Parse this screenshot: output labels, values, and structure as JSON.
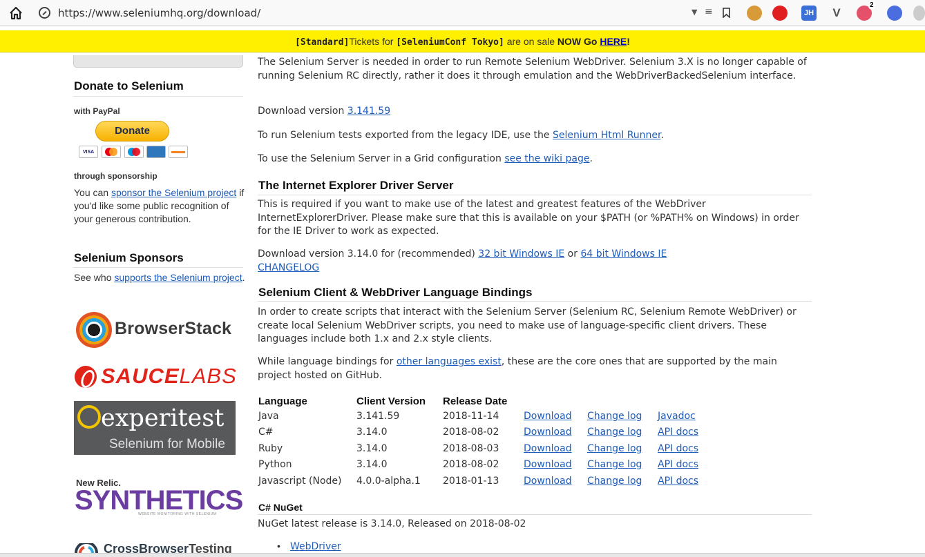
{
  "browser": {
    "url": "https://www.seleniumhq.org/download/",
    "extension_badge": "2",
    "ext_jh_label": "JH",
    "ext_v_label": "V"
  },
  "banner": {
    "part1": "[Standard]",
    "part2": "Tickets for ",
    "part3": "[SeleniumConf Tokyo]",
    "part4": " are on sale ",
    "part5": "NOW Go ",
    "link": "HERE",
    "part6": "!"
  },
  "sidebar": {
    "donate_heading": "Donate to Selenium",
    "with_paypal": "with PayPal",
    "donate_button": "Donate",
    "cards": [
      "VISA",
      "MC",
      "MAESTRO",
      "AMEX",
      "DISCOVER"
    ],
    "through_sponsorship": "through sponsorship",
    "sponsor_pre": "You can ",
    "sponsor_link": "sponsor the Selenium project",
    "sponsor_post": " if you'd like some public recognition of your generous contribution.",
    "sponsors_heading": "Selenium Sponsors",
    "supports_pre": "See who ",
    "supports_link": "supports the Selenium project",
    "supports_post": ".",
    "logos": {
      "browserstack": "BrowserStack",
      "saucelabs_bold": "SAUCE",
      "saucelabs_light": "LABS",
      "experitest": "experitest",
      "experitest_sub": "Selenium for Mobile",
      "newrelic_small": "New Relic.",
      "newrelic_big": "SYNTHETICS",
      "newrelic_tag": "WEBSITE MONITORING WITH SELENIUM",
      "cbt_bold": "CrossBrowser",
      "cbt_rest": "Testing"
    }
  },
  "main": {
    "server_intro": "The Selenium Server is needed in order to run Remote Selenium WebDriver. Selenium 3.X is no longer capable of running Selenium RC directly, rather it does it through emulation and the WebDriverBackedSelenium interface.",
    "download_version_pre": "Download version ",
    "download_version_link": "3.141.59",
    "legacy_pre": "To run Selenium tests exported from the legacy IDE, use the ",
    "legacy_link": "Selenium Html Runner",
    "legacy_post": ".",
    "grid_pre": "To use the Selenium Server in a Grid configuration ",
    "grid_link": "see the wiki page",
    "grid_post": ".",
    "ie_heading": "The Internet Explorer Driver Server",
    "ie_text": "This is required if you want to make use of the latest and greatest features of the WebDriver InternetExplorerDriver. Please make sure that this is available on your $PATH (or %PATH% on Windows) in order for the IE Driver to work as expected.",
    "ie_download_pre": "Download version 3.14.0 for (recommended) ",
    "ie_32_link": "32 bit Windows IE",
    "ie_or": " or ",
    "ie_64_link": "64 bit Windows IE",
    "ie_changelog": "CHANGELOG",
    "bindings_heading": "Selenium Client & WebDriver Language Bindings",
    "bindings_text": "In order to create scripts that interact with the Selenium Server (Selenium RC, Selenium Remote WebDriver) or create local Selenium WebDriver scripts, you need to make use of language-specific client drivers. These languages include both 1.x and 2.x style clients.",
    "other_pre": "While language bindings for ",
    "other_link": "other languages exist",
    "other_post": ", these are the core ones that are supported by the main project hosted on GitHub.",
    "table": {
      "headers": [
        "Language",
        "Client Version",
        "Release Date"
      ],
      "rows": [
        {
          "language": "Java",
          "version": "3.141.59",
          "date": "2018-11-14",
          "download": "Download",
          "changelog": "Change log",
          "docs": "Javadoc"
        },
        {
          "language": "C#",
          "version": "3.14.0",
          "date": "2018-08-02",
          "download": "Download",
          "changelog": "Change log",
          "docs": "API docs"
        },
        {
          "language": "Ruby",
          "version": "3.14.0",
          "date": "2018-08-03",
          "download": "Download",
          "changelog": "Change log",
          "docs": "API docs"
        },
        {
          "language": "Python",
          "version": "3.14.0",
          "date": "2018-08-02",
          "download": "Download",
          "changelog": "Change log",
          "docs": "API docs"
        },
        {
          "language": "Javascript (Node)",
          "version": "4.0.0-alpha.1",
          "date": "2018-01-13",
          "download": "Download",
          "changelog": "Change log",
          "docs": "API docs"
        }
      ]
    },
    "nuget_heading": "C# NuGet",
    "nuget_text": "NuGet latest release is 3.14.0, Released on 2018-08-02",
    "nuget_link": "WebDriver"
  },
  "colors": {
    "banner": "#fff000",
    "link": "#1d5bb8",
    "paypal": "#f7b100",
    "saucelabs": "#e2231a",
    "newrelic": "#6c3da0"
  }
}
